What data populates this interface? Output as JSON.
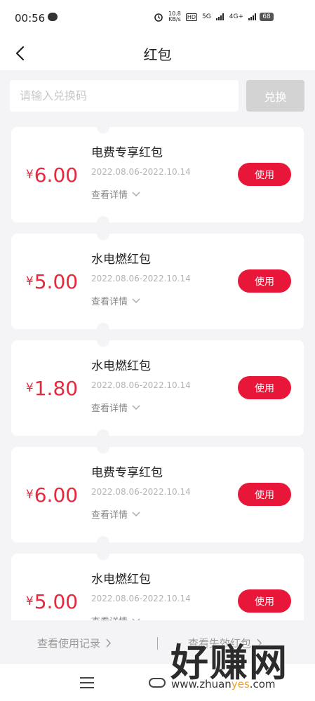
{
  "status_bar": {
    "time": "00:56",
    "net_speed_top": "10.8",
    "net_speed_bottom": "KB/s",
    "hd": "HD",
    "sig1": "5G",
    "sig2": "4G+",
    "battery": "68"
  },
  "header": {
    "title": "红包",
    "back_icon": "chevron-left-icon"
  },
  "redeem": {
    "placeholder": "请输入兑换码",
    "value": "",
    "button_label": "兑换"
  },
  "coupons": [
    {
      "currency": "¥",
      "amount": "6.00",
      "name": "电费专享红包",
      "dates": "2022.08.06-2022.10.14",
      "detail": "查看详情",
      "button": "使用"
    },
    {
      "currency": "¥",
      "amount": "5.00",
      "name": "水电燃红包",
      "dates": "2022.08.06-2022.10.14",
      "detail": "查看详情",
      "button": "使用"
    },
    {
      "currency": "¥",
      "amount": "1.80",
      "name": "水电燃红包",
      "dates": "2022.08.06-2022.10.14",
      "detail": "查看详情",
      "button": "使用"
    },
    {
      "currency": "¥",
      "amount": "6.00",
      "name": "电费专享红包",
      "dates": "2022.08.06-2022.10.14",
      "detail": "查看详情",
      "button": "使用"
    },
    {
      "currency": "¥",
      "amount": "5.00",
      "name": "水电燃红包",
      "dates": "2022.08.06-2022.10.14",
      "detail": "查看详情",
      "button": "使用"
    }
  ],
  "footer": {
    "history_link": "查看使用记录",
    "expired_link": "查看失效红包"
  },
  "watermark": {
    "main": "好赚网",
    "sub_prefix": "www.zhuan",
    "sub_accent": "yes",
    "sub_suffix": ".com"
  },
  "colors": {
    "accent_red": "#e8173a",
    "amount_red": "#e8283f",
    "background": "#f4f4f6",
    "disabled_button": "#d3d3d3"
  }
}
